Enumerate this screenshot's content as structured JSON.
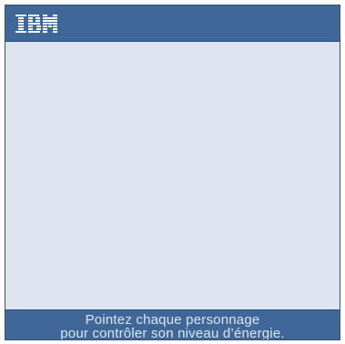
{
  "header": {
    "logo_text": "IBM"
  },
  "footer": {
    "line1": "Pointez chaque personnage",
    "line2": "pour contrôler son niveau d’énergie."
  },
  "colors": {
    "bar": "#3f6899",
    "panel": "#dfe5f0",
    "text": "#dbe4f2"
  }
}
